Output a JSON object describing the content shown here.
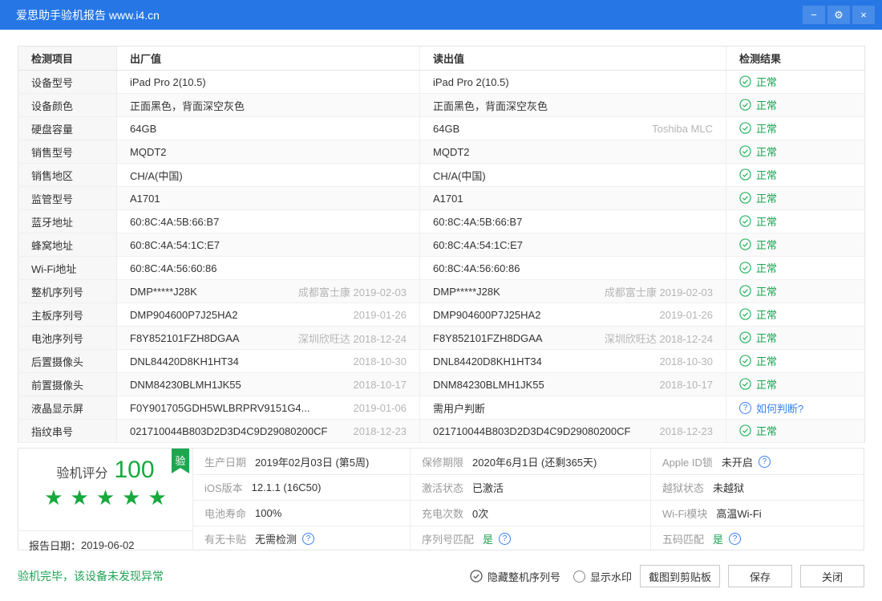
{
  "titlebar": {
    "title": "爱思助手验机报告 www.i4.cn"
  },
  "icons": {
    "minimize": "−",
    "settings": "⚙",
    "close": "×",
    "help": "?",
    "badge": "验",
    "star": "★"
  },
  "table": {
    "headers": [
      "检测项目",
      "出厂值",
      "读出值",
      "检测结果"
    ],
    "rows": [
      {
        "item": "设备型号",
        "factory": "iPad Pro 2(10.5)",
        "factory_note": "",
        "read": "iPad Pro 2(10.5)",
        "read_note": "",
        "result": "正常",
        "result_type": "ok"
      },
      {
        "item": "设备颜色",
        "factory": "正面黑色，背面深空灰色",
        "factory_note": "",
        "read": "正面黑色，背面深空灰色",
        "read_note": "",
        "result": "正常",
        "result_type": "ok"
      },
      {
        "item": "硬盘容量",
        "factory": "64GB",
        "factory_note": "",
        "read": "64GB",
        "read_note": "Toshiba MLC",
        "result": "正常",
        "result_type": "ok"
      },
      {
        "item": "销售型号",
        "factory": "MQDT2",
        "factory_note": "",
        "read": "MQDT2",
        "read_note": "",
        "result": "正常",
        "result_type": "ok"
      },
      {
        "item": "销售地区",
        "factory": "CH/A(中国)",
        "factory_note": "",
        "read": "CH/A(中国)",
        "read_note": "",
        "result": "正常",
        "result_type": "ok"
      },
      {
        "item": "监管型号",
        "factory": "A1701",
        "factory_note": "",
        "read": "A1701",
        "read_note": "",
        "result": "正常",
        "result_type": "ok"
      },
      {
        "item": "蓝牙地址",
        "factory": "60:8C:4A:5B:66:B7",
        "factory_note": "",
        "read": "60:8C:4A:5B:66:B7",
        "read_note": "",
        "result": "正常",
        "result_type": "ok"
      },
      {
        "item": "蜂窝地址",
        "factory": "60:8C:4A:54:1C:E7",
        "factory_note": "",
        "read": "60:8C:4A:54:1C:E7",
        "read_note": "",
        "result": "正常",
        "result_type": "ok"
      },
      {
        "item": "Wi-Fi地址",
        "factory": "60:8C:4A:56:60:86",
        "factory_note": "",
        "read": "60:8C:4A:56:60:86",
        "read_note": "",
        "result": "正常",
        "result_type": "ok"
      },
      {
        "item": "整机序列号",
        "factory": "DMP*****J28K",
        "factory_note": "成都富士康 2019-02-03",
        "read": "DMP*****J28K",
        "read_note": "成都富士康 2019-02-03",
        "result": "正常",
        "result_type": "ok"
      },
      {
        "item": "主板序列号",
        "factory": "DMP904600P7J25HA2",
        "factory_note": "2019-01-26",
        "read": "DMP904600P7J25HA2",
        "read_note": "2019-01-26",
        "result": "正常",
        "result_type": "ok"
      },
      {
        "item": "电池序列号",
        "factory": "F8Y852101FZH8DGAA",
        "factory_note": "深圳欣旺达 2018-12-24",
        "read": "F8Y852101FZH8DGAA",
        "read_note": "深圳欣旺达 2018-12-24",
        "result": "正常",
        "result_type": "ok"
      },
      {
        "item": "后置摄像头",
        "factory": "DNL84420D8KH1HT34",
        "factory_note": "2018-10-30",
        "read": "DNL84420D8KH1HT34",
        "read_note": "2018-10-30",
        "result": "正常",
        "result_type": "ok"
      },
      {
        "item": "前置摄像头",
        "factory": "DNM84230BLMH1JK55",
        "factory_note": "2018-10-17",
        "read": "DNM84230BLMH1JK55",
        "read_note": "2018-10-17",
        "result": "正常",
        "result_type": "ok"
      },
      {
        "item": "液晶显示屏",
        "factory": "F0Y901705GDH5WLBRPRV9151G4...",
        "factory_note": "2019-01-06",
        "read": "需用户判断",
        "read_note": "",
        "result": "如何判断?",
        "result_type": "help"
      },
      {
        "item": "指纹串号",
        "factory": "021710044B803D2D3D4C9D29080200CF",
        "factory_note": "2018-12-23",
        "read": "021710044B803D2D3D4C9D29080200CF",
        "read_note": "2018-12-23",
        "result": "正常",
        "result_type": "ok"
      }
    ]
  },
  "summary": {
    "score_label": "验机评分",
    "score": "100",
    "stars": 5,
    "report_date_label": "报告日期：",
    "report_date": "2019-06-02",
    "cells": [
      {
        "label": "生产日期",
        "value": "2019年02月03日 (第5周)",
        "value_class": "",
        "help": false
      },
      {
        "label": "保修期限",
        "value": "2020年6月1日 (还剩365天)",
        "value_class": "",
        "help": false
      },
      {
        "label": "Apple ID锁",
        "value": "未开启",
        "value_class": "",
        "help": true
      },
      {
        "label": "iOS版本",
        "value": "12.1.1 (16C50)",
        "value_class": "",
        "help": false
      },
      {
        "label": "激活状态",
        "value": "已激活",
        "value_class": "",
        "help": false
      },
      {
        "label": "越狱状态",
        "value": "未越狱",
        "value_class": "",
        "help": false
      },
      {
        "label": "电池寿命",
        "value": "100%",
        "value_class": "",
        "help": false
      },
      {
        "label": "充电次数",
        "value": "0次",
        "value_class": "",
        "help": false
      },
      {
        "label": "Wi-Fi模块",
        "value": "高温Wi-Fi",
        "value_class": "",
        "help": false
      },
      {
        "label": "有无卡贴",
        "value": "无需检测",
        "value_class": "",
        "help": true
      },
      {
        "label": "序列号匹配",
        "value": "是",
        "value_class": "green",
        "help": true
      },
      {
        "label": "五码匹配",
        "value": "是",
        "value_class": "green",
        "help": true
      }
    ]
  },
  "footer": {
    "status": "验机完毕，该设备未发现异常",
    "hide_serial_label": "隐藏整机序列号",
    "watermark_label": "显示水印",
    "screenshot_button": "截图到剪贴板",
    "save_button": "保存",
    "close_button": "关闭"
  }
}
